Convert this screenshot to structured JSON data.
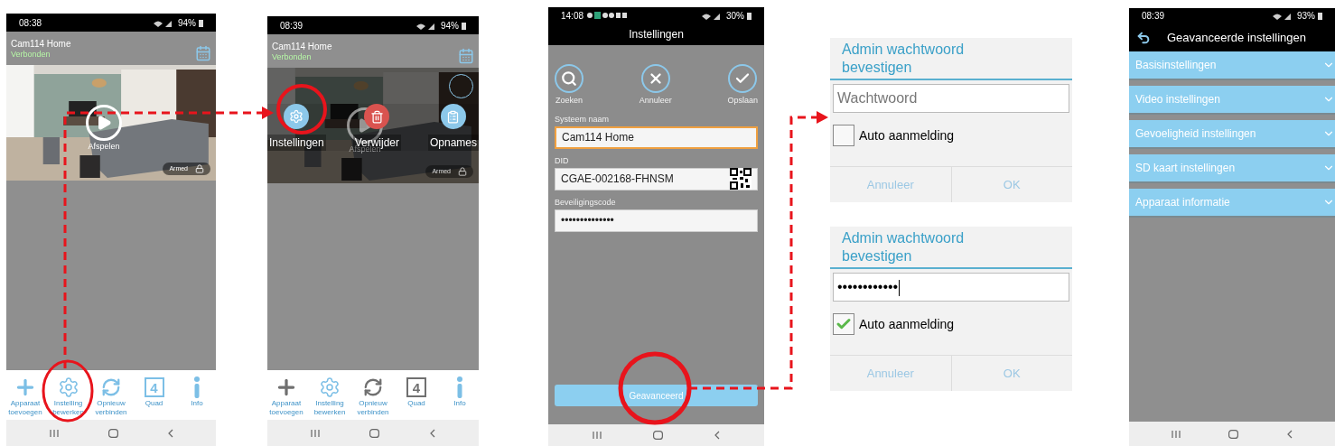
{
  "screens": [
    {
      "kind": "camera_list",
      "status_bar": {
        "time": "08:38",
        "battery": "94%"
      },
      "device": {
        "name": "Cam114 Home",
        "status": "Verbonden"
      },
      "video": {
        "kind": "picture",
        "play_label": "Afspelen",
        "armed_label": "Armed",
        "dimmed": false
      },
      "toolbar": [
        {
          "kind": "add",
          "lines": [
            "Apparaat",
            "toevoegen"
          ],
          "active": true
        },
        {
          "kind": "settings",
          "lines": [
            "Instelling",
            "bewerken"
          ],
          "active": true
        },
        {
          "kind": "refresh",
          "lines": [
            "Opnieuw",
            "verbinden"
          ],
          "active": true
        },
        {
          "kind": "quad",
          "icon_text": "4",
          "lines": [
            "Quad"
          ],
          "active": true
        },
        {
          "kind": "info",
          "lines": [
            "Info"
          ],
          "active": true
        }
      ]
    },
    {
      "kind": "camera_list",
      "status_bar": {
        "time": "08:39",
        "battery": "94%"
      },
      "device": {
        "name": "Cam114 Home",
        "status": "Verbonden"
      },
      "video": {
        "kind": "picture",
        "play_label": "Afspelen",
        "armed_label": "Armed",
        "dimmed": true
      },
      "menu": [
        {
          "kind": "settings",
          "label": "Instellingen"
        },
        {
          "kind": "delete",
          "label": "Verwijder"
        },
        {
          "kind": "recordings",
          "label": "Opnames"
        }
      ],
      "toolbar": [
        {
          "kind": "add",
          "lines": [
            "Apparaat",
            "toevoegen"
          ],
          "active": false
        },
        {
          "kind": "settings",
          "lines": [
            "Instelling",
            "bewerken"
          ],
          "active": true
        },
        {
          "kind": "refresh",
          "lines": [
            "Opnieuw",
            "verbinden"
          ],
          "active": false
        },
        {
          "kind": "quad",
          "icon_text": "4",
          "lines": [
            "Quad"
          ],
          "active": false
        },
        {
          "kind": "info",
          "lines": [
            "Info"
          ],
          "active": true
        }
      ]
    },
    {
      "kind": "settings_form",
      "status_bar": {
        "time": "14:08",
        "battery": "30%"
      },
      "title": "Instellingen",
      "actions": [
        {
          "kind": "search",
          "label": "Zoeken"
        },
        {
          "kind": "cancel",
          "label": "Annuleer"
        },
        {
          "kind": "save",
          "label": "Opslaan"
        }
      ],
      "fields": [
        {
          "kind": "text",
          "label": "Systeem naam",
          "value": "Cam114 Home",
          "focused": true
        },
        {
          "kind": "qr",
          "label": "DID",
          "value": "CGAE-002168-FHNSM",
          "focused": false
        },
        {
          "kind": "password",
          "label": "Beveiligingscode",
          "value": "••••••••••••••",
          "focused": false
        }
      ],
      "button": "Geavanceerd"
    },
    {
      "kind": "dialogs",
      "items": [
        {
          "title": "Admin wachtwoord bevestigen",
          "input": {
            "placeholder": "Wachtwoord"
          },
          "checkbox": {
            "label": "Auto aanmelding",
            "checked": false
          },
          "buttons": [
            "Annuleer",
            "OK"
          ]
        },
        {
          "title": "Admin wachtwoord bevestigen",
          "input": {
            "value": "••••••••••••"
          },
          "checkbox": {
            "label": "Auto aanmelding",
            "checked": true
          },
          "buttons": [
            "Annuleer",
            "OK"
          ]
        }
      ]
    },
    {
      "kind": "advanced",
      "status_bar": {
        "time": "08:39",
        "battery": "93%"
      },
      "title": "Geavanceerde instellingen",
      "sections": [
        {
          "label": "Basisinstellingen",
          "expanded": false
        },
        {
          "label": "Video instellingen",
          "expanded": false
        },
        {
          "label": "Gevoeligheid instellingen",
          "expanded": false
        },
        {
          "label": "SD kaart instellingen",
          "expanded": false
        },
        {
          "label": "Apparaat informatie",
          "expanded": false
        }
      ]
    }
  ]
}
